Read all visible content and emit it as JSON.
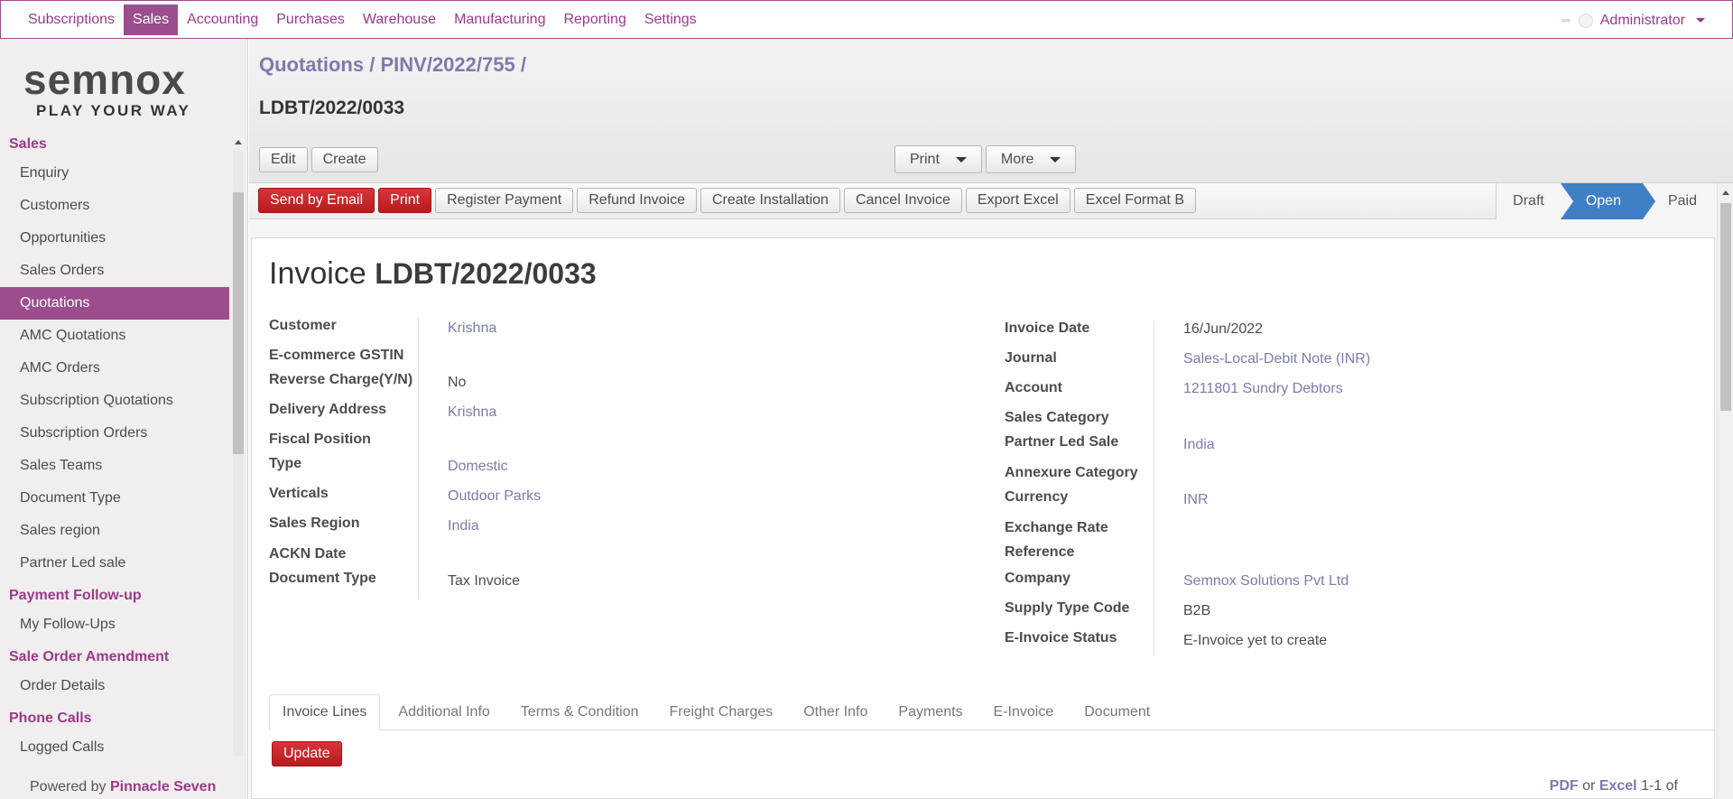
{
  "topmenu": {
    "items": [
      {
        "label": "Subscriptions"
      },
      {
        "label": "Sales"
      },
      {
        "label": "Accounting"
      },
      {
        "label": "Purchases"
      },
      {
        "label": "Warehouse"
      },
      {
        "label": "Manufacturing"
      },
      {
        "label": "Reporting"
      },
      {
        "label": "Settings"
      }
    ],
    "active": "Sales",
    "user": "Administrator"
  },
  "logo": {
    "word": "semnox",
    "tagline": "PLAY YOUR WAY"
  },
  "sidebar": {
    "sections": [
      {
        "title": "Sales",
        "items": [
          "Enquiry",
          "Customers",
          "Opportunities",
          "Sales Orders",
          "Quotations",
          "AMC Quotations",
          "AMC Orders",
          "Subscription Quotations",
          "Subscription Orders",
          "Sales Teams",
          "Document Type",
          "Sales region",
          "Partner Led sale"
        ]
      },
      {
        "title": "Payment Follow-up",
        "items": [
          "My Follow-Ups"
        ]
      },
      {
        "title": "Sale Order Amendment",
        "items": [
          "Order Details"
        ]
      },
      {
        "title": "Phone Calls",
        "items": [
          "Logged Calls"
        ]
      }
    ],
    "active_item": "Quotations",
    "powered_prefix": "Powered by",
    "powered_name": "Pinnacle Seven"
  },
  "breadcrumb": {
    "part1": "Quotations",
    "sep": "/",
    "part2": "PINV/2022/755",
    "trail": "/"
  },
  "record_title": "LDBT/2022/0033",
  "control": {
    "edit": "Edit",
    "create": "Create",
    "print": "Print",
    "more": "More"
  },
  "actions": [
    "Send by Email",
    "Print",
    "Register Payment",
    "Refund Invoice",
    "Create Installation",
    "Cancel Invoice",
    "Export Excel",
    "Excel Format B"
  ],
  "stages": {
    "draft": "Draft",
    "open": "Open",
    "paid": "Paid",
    "current": "Open"
  },
  "invoice": {
    "title_prefix": "Invoice",
    "number": "LDBT/2022/0033",
    "left_fields": [
      {
        "label": "Customer",
        "value": "Krishna",
        "link": true
      },
      {
        "label": "E-commerce GSTIN",
        "value": "",
        "link": false
      },
      {
        "label": "Reverse Charge(Y/N)",
        "value": "No",
        "link": false
      },
      {
        "label": "Delivery Address",
        "value": "Krishna",
        "link": true
      },
      {
        "label": "Fiscal Position",
        "value": "",
        "link": false
      },
      {
        "label": "Type",
        "value": "Domestic",
        "link": true
      },
      {
        "label": "Verticals",
        "value": "Outdoor Parks",
        "link": true
      },
      {
        "label": "Sales Region",
        "value": "India",
        "link": true
      },
      {
        "label": "ACKN Date",
        "value": "",
        "link": false
      },
      {
        "label": "Document Type",
        "value": "Tax Invoice",
        "link": false
      }
    ],
    "right_fields": [
      {
        "label": "Invoice Date",
        "value": "16/Jun/2022",
        "link": false
      },
      {
        "label": "Journal",
        "value": "Sales-Local-Debit Note (INR)",
        "link": true
      },
      {
        "label": "Account",
        "value": "1211801 Sundry Debtors",
        "link": true
      },
      {
        "label": "Sales Category",
        "value": "",
        "link": false
      },
      {
        "label": "Partner Led Sale",
        "value": "India",
        "link": true
      },
      {
        "label": "Annexure Category",
        "value": "",
        "link": false
      },
      {
        "label": "Currency",
        "value": "INR",
        "link": true
      },
      {
        "label": "Exchange Rate",
        "value": "",
        "link": false
      },
      {
        "label": "Reference",
        "value": "",
        "link": false
      },
      {
        "label": "Company",
        "value": "Semnox Solutions Pvt Ltd",
        "link": true
      },
      {
        "label": "Supply Type Code",
        "value": "B2B",
        "link": false
      },
      {
        "label": "E-Invoice Status",
        "value": "E-Invoice yet to create",
        "link": false
      }
    ]
  },
  "tabs": [
    "Invoice Lines",
    "Additional Info",
    "Terms & Condition",
    "Freight Charges",
    "Other Info",
    "Payments",
    "E-Invoice",
    "Document"
  ],
  "active_tab": "Invoice Lines",
  "update_label": "Update",
  "pager": {
    "pdf": "PDF",
    "or": "or",
    "excel": "Excel",
    "range": "1-1 of"
  },
  "colors": {
    "brand": "#9b4d8d",
    "link": "#7c7bad",
    "danger": "#c62828",
    "stage_active": "#3f7fc6"
  }
}
